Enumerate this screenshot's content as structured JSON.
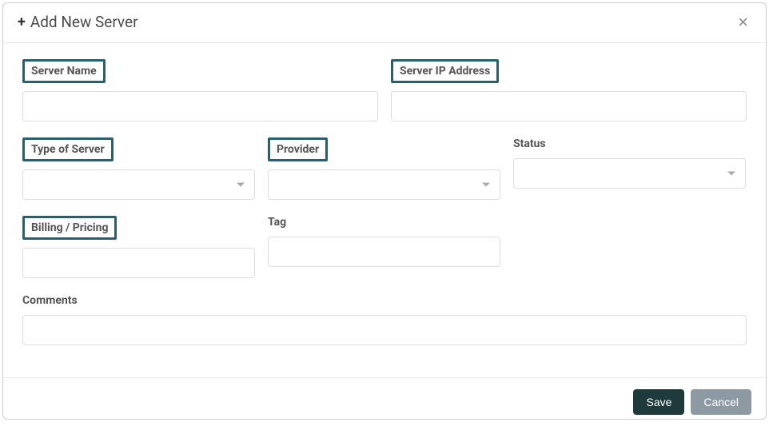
{
  "header": {
    "title": "Add New Server",
    "close": "×"
  },
  "labels": {
    "server_name": "Server Name",
    "server_ip": "Server IP Address",
    "type_of_server": "Type of Server",
    "provider": "Provider",
    "status": "Status",
    "billing": "Billing / Pricing",
    "tag": "Tag",
    "comments": "Comments"
  },
  "buttons": {
    "save": "Save",
    "cancel": "Cancel"
  },
  "values": {
    "server_name": "",
    "server_ip": "",
    "type_of_server": "",
    "provider": "",
    "status": "",
    "billing": "",
    "tag": "",
    "comments": ""
  }
}
